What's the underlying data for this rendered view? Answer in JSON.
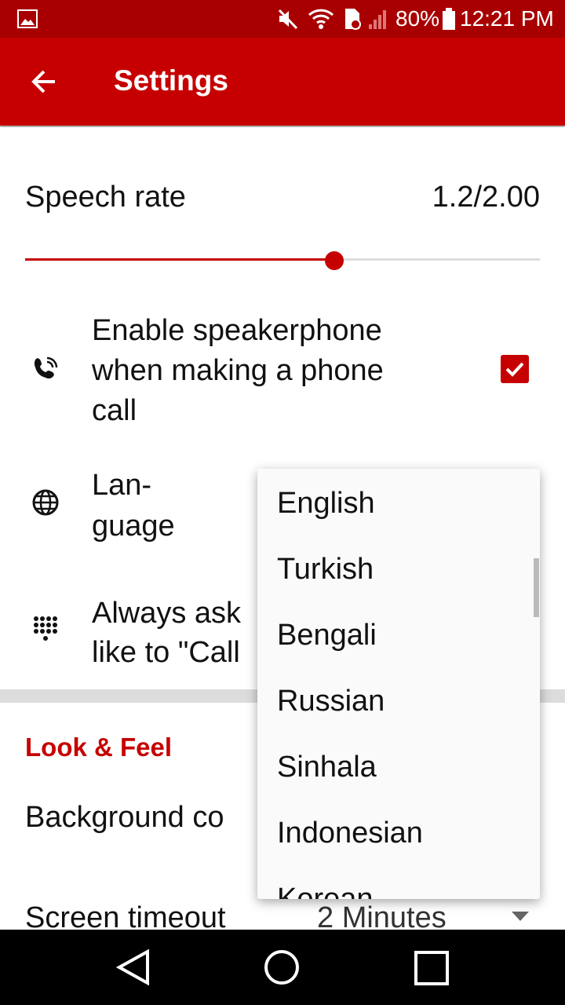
{
  "status_bar": {
    "battery": "80%",
    "time": "12:21 PM",
    "icons": [
      "image-icon",
      "mute-icon",
      "wifi-icon",
      "sd-card-error-icon",
      "signal-icon",
      "battery-icon"
    ]
  },
  "app_bar": {
    "title": "Settings",
    "back_icon": "arrow-left-icon"
  },
  "speech_rate": {
    "label": "Speech rate",
    "value_text": "1.2/2.00",
    "value": 1.2,
    "max": 2.0
  },
  "speakerphone": {
    "label_lines": [
      "Enable speakerphone",
      "when making a phone",
      "call"
    ],
    "checked": true
  },
  "language": {
    "label_lines": [
      "Lan-",
      "guage"
    ]
  },
  "always_ask": {
    "label_lines": [
      "Always ask",
      "like to \"Call"
    ]
  },
  "look_feel": {
    "header": "Look & Feel",
    "background_label": "Background co",
    "screen_timeout_label": "Screen timeout",
    "screen_timeout_value": "2 Minutes"
  },
  "dropdown": {
    "options": [
      "English",
      "Turkish",
      "Bengali",
      "Russian",
      "Sinhala",
      "Indonesian",
      "Korean"
    ]
  },
  "colors": {
    "accent": "#c60000",
    "status_bar": "#a80000"
  }
}
